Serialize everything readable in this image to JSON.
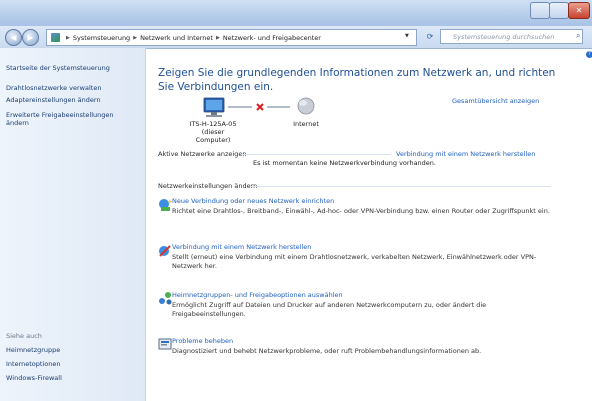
{
  "window": {
    "controls": [
      "minimize",
      "maximize",
      "close"
    ],
    "close_glyph": "✕"
  },
  "addressbar": {
    "breadcrumb": [
      "Systemsteuerung",
      "Netzwerk und Internet",
      "Netzwerk- und Freigabecenter"
    ],
    "search_placeholder": "Systemsteuerung durchsuchen"
  },
  "sidebar": {
    "top_links": [
      "Startseite der Systemsteuerung",
      "Drahtlosnetzwerke verwalten",
      "Adaptereinstellungen ändern",
      "Erweiterte Freigabeeinstellungen ändern"
    ],
    "see_also_label": "Siehe auch",
    "see_also_links": [
      "Heimnetzgruppe",
      "Internetoptionen",
      "Windows-Firewall"
    ]
  },
  "main": {
    "heading": "Zeigen Sie die grundlegenden Informationen zum Netzwerk an, und richten Sie Verbindungen ein.",
    "full_map_link": "Gesamtübersicht anzeigen",
    "computer_name": "ITS-H-125A-05",
    "computer_sub": "(dieser Computer)",
    "internet_label": "Internet",
    "active_networks_label": "Aktive Netzwerke anzeigen",
    "connect_link": "Verbindung mit einem Netzwerk herstellen",
    "no_connection": "Es ist momentan keine Netzwerkverbindung vorhanden.",
    "change_settings_label": "Netzwerkeinstellungen ändern",
    "tasks": [
      {
        "title": "Neue Verbindung oder neues Netzwerk einrichten",
        "desc": "Richtet eine Drahtlos-, Breitband-, Einwähl-, Ad-hoc- oder VPN-Verbindung bzw. einen Router oder Zugriffspunkt ein."
      },
      {
        "title": "Verbindung mit einem Netzwerk herstellen",
        "desc": "Stellt (erneut) eine Verbindung mit einem Drahtlosnetzwerk, verkabelten Netzwerk, Einwählnetzwerk oder VPN-Netzwerk her."
      },
      {
        "title": "Heimnetzgruppen- und Freigabeoptionen auswählen",
        "desc": "Ermöglicht Zugriff auf Dateien und Drucker auf anderen Netzwerkcomputern zu, oder ändert die Freigabeeinstellungen."
      },
      {
        "title": "Probleme beheben",
        "desc": "Diagnostiziert und behebt Netzwerkprobleme, oder ruft Problembehandlungsinformationen ab."
      }
    ]
  }
}
